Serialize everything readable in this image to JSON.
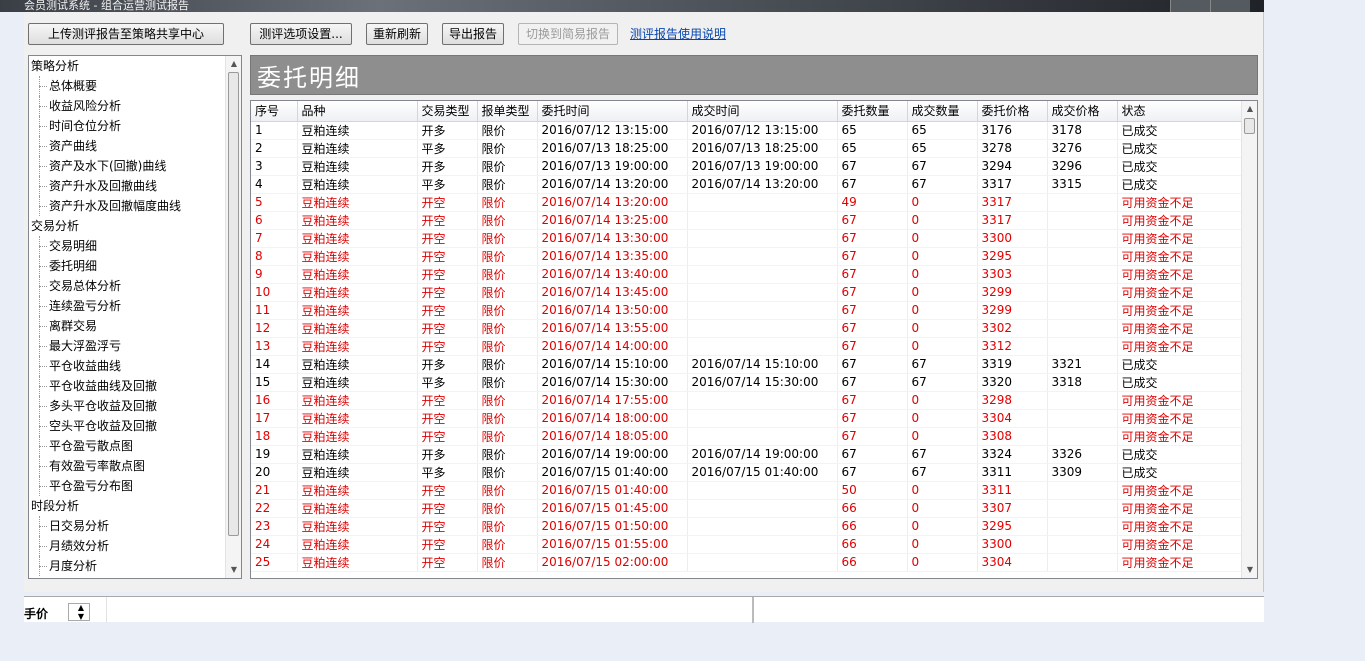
{
  "window": {
    "title": "会员测试系统 - 组合运营测试报告"
  },
  "toolbar": {
    "upload_label": "上传测评报告至策略共享中心",
    "options_label": "测评选项设置...",
    "refresh_label": "重新刷新",
    "export_label": "导出报告",
    "switch_label": "切换到简易报告",
    "help_link": "测评报告使用说明"
  },
  "tree": {
    "categories": [
      {
        "label": "策略分析",
        "items": [
          "总体概要",
          "收益风险分析",
          "时间仓位分析",
          "资产曲线",
          "资产及水下(回撤)曲线",
          "资产升水及回撤曲线",
          "资产升水及回撤幅度曲线"
        ]
      },
      {
        "label": "交易分析",
        "items": [
          "交易明细",
          "委托明细",
          "交易总体分析",
          "连续盈亏分析",
          "离群交易",
          "最大浮盈浮亏",
          "平仓收益曲线",
          "平仓收益曲线及回撤",
          "多头平仓收益及回撤",
          "空头平仓收益及回撤",
          "平仓盈亏散点图",
          "有效盈亏率散点图",
          "平仓盈亏分布图"
        ]
      },
      {
        "label": "时段分析",
        "items": [
          "日交易分析",
          "月绩效分析",
          "月度分析"
        ]
      }
    ]
  },
  "report": {
    "title": "委托明细",
    "columns": [
      "序号",
      "品种",
      "交易类型",
      "报单类型",
      "委托时间",
      "成交时间",
      "委托数量",
      "成交数量",
      "委托价格",
      "成交价格",
      "状态"
    ],
    "rows": [
      [
        "1",
        "豆粕连续",
        "开多",
        "限价",
        "2016/07/12 13:15:00",
        "2016/07/12 13:15:00",
        "65",
        "65",
        "3176",
        "3178",
        "已成交"
      ],
      [
        "2",
        "豆粕连续",
        "平多",
        "限价",
        "2016/07/13 18:25:00",
        "2016/07/13 18:25:00",
        "65",
        "65",
        "3278",
        "3276",
        "已成交"
      ],
      [
        "3",
        "豆粕连续",
        "开多",
        "限价",
        "2016/07/13 19:00:00",
        "2016/07/13 19:00:00",
        "67",
        "67",
        "3294",
        "3296",
        "已成交"
      ],
      [
        "4",
        "豆粕连续",
        "平多",
        "限价",
        "2016/07/14 13:20:00",
        "2016/07/14 13:20:00",
        "67",
        "67",
        "3317",
        "3315",
        "已成交"
      ],
      [
        "5",
        "豆粕连续",
        "开空",
        "限价",
        "2016/07/14 13:20:00",
        "",
        "49",
        "0",
        "3317",
        "",
        "可用资金不足"
      ],
      [
        "6",
        "豆粕连续",
        "开空",
        "限价",
        "2016/07/14 13:25:00",
        "",
        "67",
        "0",
        "3317",
        "",
        "可用资金不足"
      ],
      [
        "7",
        "豆粕连续",
        "开空",
        "限价",
        "2016/07/14 13:30:00",
        "",
        "67",
        "0",
        "3300",
        "",
        "可用资金不足"
      ],
      [
        "8",
        "豆粕连续",
        "开空",
        "限价",
        "2016/07/14 13:35:00",
        "",
        "67",
        "0",
        "3295",
        "",
        "可用资金不足"
      ],
      [
        "9",
        "豆粕连续",
        "开空",
        "限价",
        "2016/07/14 13:40:00",
        "",
        "67",
        "0",
        "3303",
        "",
        "可用资金不足"
      ],
      [
        "10",
        "豆粕连续",
        "开空",
        "限价",
        "2016/07/14 13:45:00",
        "",
        "67",
        "0",
        "3299",
        "",
        "可用资金不足"
      ],
      [
        "11",
        "豆粕连续",
        "开空",
        "限价",
        "2016/07/14 13:50:00",
        "",
        "67",
        "0",
        "3299",
        "",
        "可用资金不足"
      ],
      [
        "12",
        "豆粕连续",
        "开空",
        "限价",
        "2016/07/14 13:55:00",
        "",
        "67",
        "0",
        "3302",
        "",
        "可用资金不足"
      ],
      [
        "13",
        "豆粕连续",
        "开空",
        "限价",
        "2016/07/14 14:00:00",
        "",
        "67",
        "0",
        "3312",
        "",
        "可用资金不足"
      ],
      [
        "14",
        "豆粕连续",
        "开多",
        "限价",
        "2016/07/14 15:10:00",
        "2016/07/14 15:10:00",
        "67",
        "67",
        "3319",
        "3321",
        "已成交"
      ],
      [
        "15",
        "豆粕连续",
        "平多",
        "限价",
        "2016/07/14 15:30:00",
        "2016/07/14 15:30:00",
        "67",
        "67",
        "3320",
        "3318",
        "已成交"
      ],
      [
        "16",
        "豆粕连续",
        "开空",
        "限价",
        "2016/07/14 17:55:00",
        "",
        "67",
        "0",
        "3298",
        "",
        "可用资金不足"
      ],
      [
        "17",
        "豆粕连续",
        "开空",
        "限价",
        "2016/07/14 18:00:00",
        "",
        "67",
        "0",
        "3304",
        "",
        "可用资金不足"
      ],
      [
        "18",
        "豆粕连续",
        "开空",
        "限价",
        "2016/07/14 18:05:00",
        "",
        "67",
        "0",
        "3308",
        "",
        "可用资金不足"
      ],
      [
        "19",
        "豆粕连续",
        "开多",
        "限价",
        "2016/07/14 19:00:00",
        "2016/07/14 19:00:00",
        "67",
        "67",
        "3324",
        "3326",
        "已成交"
      ],
      [
        "20",
        "豆粕连续",
        "平多",
        "限价",
        "2016/07/15 01:40:00",
        "2016/07/15 01:40:00",
        "67",
        "67",
        "3311",
        "3309",
        "已成交"
      ],
      [
        "21",
        "豆粕连续",
        "开空",
        "限价",
        "2016/07/15 01:40:00",
        "",
        "50",
        "0",
        "3311",
        "",
        "可用资金不足"
      ],
      [
        "22",
        "豆粕连续",
        "开空",
        "限价",
        "2016/07/15 01:45:00",
        "",
        "66",
        "0",
        "3307",
        "",
        "可用资金不足"
      ],
      [
        "23",
        "豆粕连续",
        "开空",
        "限价",
        "2016/07/15 01:50:00",
        "",
        "66",
        "0",
        "3295",
        "",
        "可用资金不足"
      ],
      [
        "24",
        "豆粕连续",
        "开空",
        "限价",
        "2016/07/15 01:55:00",
        "",
        "66",
        "0",
        "3300",
        "",
        "可用资金不足"
      ],
      [
        "25",
        "豆粕连续",
        "开空",
        "限价",
        "2016/07/15 02:00:00",
        "",
        "66",
        "0",
        "3304",
        "",
        "可用资金不足"
      ]
    ],
    "status_colors": {
      "已成交": "#000000",
      "可用资金不足": "#e00000"
    }
  },
  "bottom": {
    "price_label": "手价"
  },
  "icons": {
    "scroll_up": "up-arrow-icon",
    "scroll_down": "down-arrow-icon"
  }
}
